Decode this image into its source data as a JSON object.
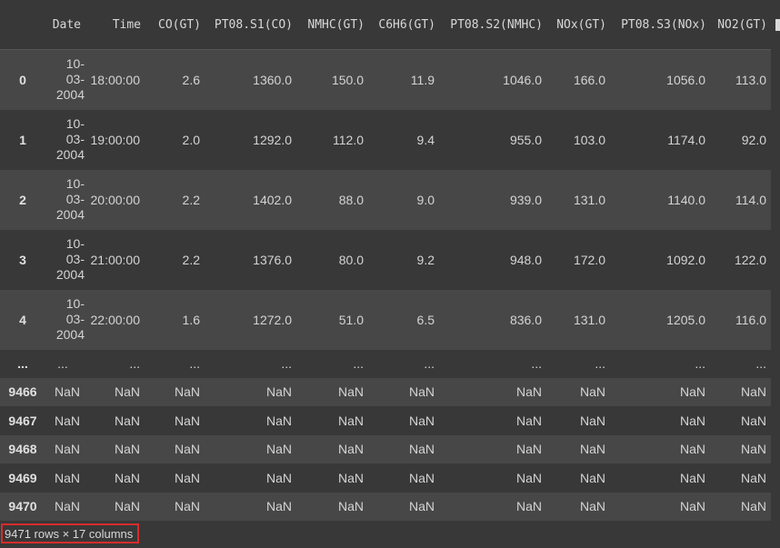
{
  "table": {
    "columns": [
      "",
      "Date",
      "Time",
      "CO(GT)",
      "PT08.S1(CO)",
      "NMHC(GT)",
      "C6H6(GT)",
      "PT08.S2(NMHC)",
      "NOx(GT)",
      "PT08.S3(NOx)",
      "NO2(GT)"
    ],
    "head_rows": [
      {
        "index": "0",
        "date": [
          "10-",
          "03-",
          "2004"
        ],
        "cells": [
          "18:00:00",
          "2.6",
          "1360.0",
          "150.0",
          "11.9",
          "1046.0",
          "166.0",
          "1056.0",
          "113.0"
        ]
      },
      {
        "index": "1",
        "date": [
          "10-",
          "03-",
          "2004"
        ],
        "cells": [
          "19:00:00",
          "2.0",
          "1292.0",
          "112.0",
          "9.4",
          "955.0",
          "103.0",
          "1174.0",
          "92.0"
        ]
      },
      {
        "index": "2",
        "date": [
          "10-",
          "03-",
          "2004"
        ],
        "cells": [
          "20:00:00",
          "2.2",
          "1402.0",
          "88.0",
          "9.0",
          "939.0",
          "131.0",
          "1140.0",
          "114.0"
        ]
      },
      {
        "index": "3",
        "date": [
          "10-",
          "03-",
          "2004"
        ],
        "cells": [
          "21:00:00",
          "2.2",
          "1376.0",
          "80.0",
          "9.2",
          "948.0",
          "172.0",
          "1092.0",
          "122.0"
        ]
      },
      {
        "index": "4",
        "date": [
          "10-",
          "03-",
          "2004"
        ],
        "cells": [
          "22:00:00",
          "1.6",
          "1272.0",
          "51.0",
          "6.5",
          "836.0",
          "131.0",
          "1205.0",
          "116.0"
        ]
      }
    ],
    "ellipsis": "...",
    "tail_rows": [
      {
        "index": "9466",
        "cells": [
          "NaN",
          "NaN",
          "NaN",
          "NaN",
          "NaN",
          "NaN",
          "NaN",
          "NaN",
          "NaN",
          "NaN"
        ]
      },
      {
        "index": "9467",
        "cells": [
          "NaN",
          "NaN",
          "NaN",
          "NaN",
          "NaN",
          "NaN",
          "NaN",
          "NaN",
          "NaN",
          "NaN"
        ]
      },
      {
        "index": "9468",
        "cells": [
          "NaN",
          "NaN",
          "NaN",
          "NaN",
          "NaN",
          "NaN",
          "NaN",
          "NaN",
          "NaN",
          "NaN"
        ]
      },
      {
        "index": "9469",
        "cells": [
          "NaN",
          "NaN",
          "NaN",
          "NaN",
          "NaN",
          "NaN",
          "NaN",
          "NaN",
          "NaN",
          "NaN"
        ]
      },
      {
        "index": "9470",
        "cells": [
          "NaN",
          "NaN",
          "NaN",
          "NaN",
          "NaN",
          "NaN",
          "NaN",
          "NaN",
          "NaN",
          "NaN"
        ]
      }
    ]
  },
  "footer": {
    "shape_text": "9471 rows × 17 columns",
    "highlight_color": "#d62c2c"
  },
  "colors": {
    "background": "#383838",
    "row_alt": "#474747",
    "text": "#d4d4d4"
  }
}
